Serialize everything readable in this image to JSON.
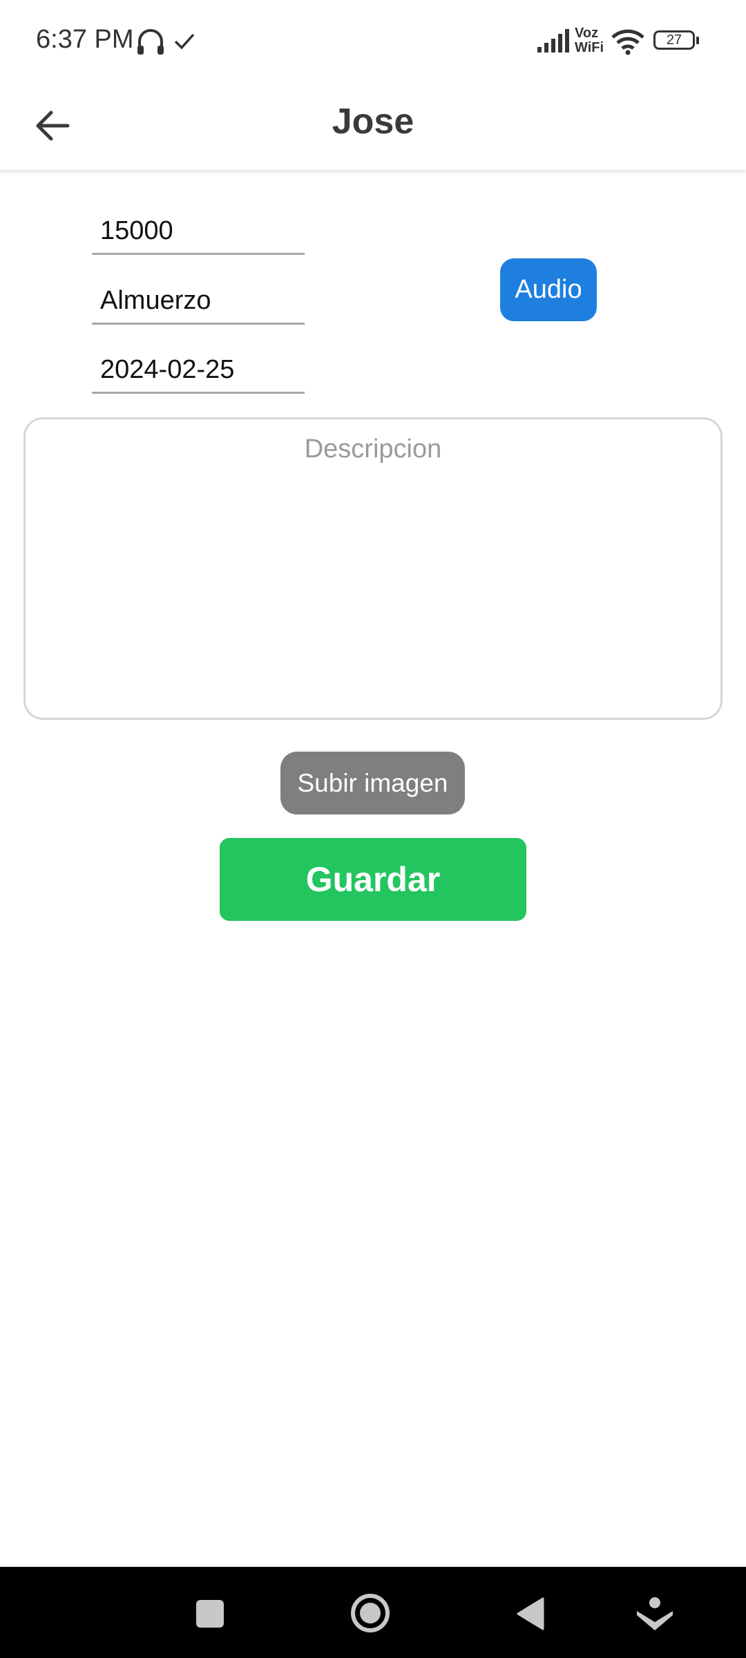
{
  "status_bar": {
    "time": "6:37 PM",
    "voz_label": "Voz",
    "wifi_label": "WiFi",
    "battery": "27",
    "icons": [
      "headphones-icon",
      "check-icon",
      "signal-icon",
      "wifi-icon",
      "battery-icon"
    ]
  },
  "app_bar": {
    "title": "Jose",
    "back_icon": "arrow-left-icon"
  },
  "form": {
    "amount_value": "15000",
    "concept_value": "Almuerzo",
    "date_value": "2024-02-25",
    "audio_label": "Audio",
    "description_value": "",
    "description_placeholder": "Descripcion",
    "upload_label": "Subir imagen",
    "save_label": "Guardar"
  },
  "colors": {
    "audio_button": "#1e7fe0",
    "upload_button": "#7f7f7f",
    "save_button": "#22c55e",
    "nav_bar": "#000000"
  },
  "nav_bar": {
    "icons": [
      "recents-icon",
      "home-icon",
      "back-icon",
      "assist-icon"
    ]
  }
}
